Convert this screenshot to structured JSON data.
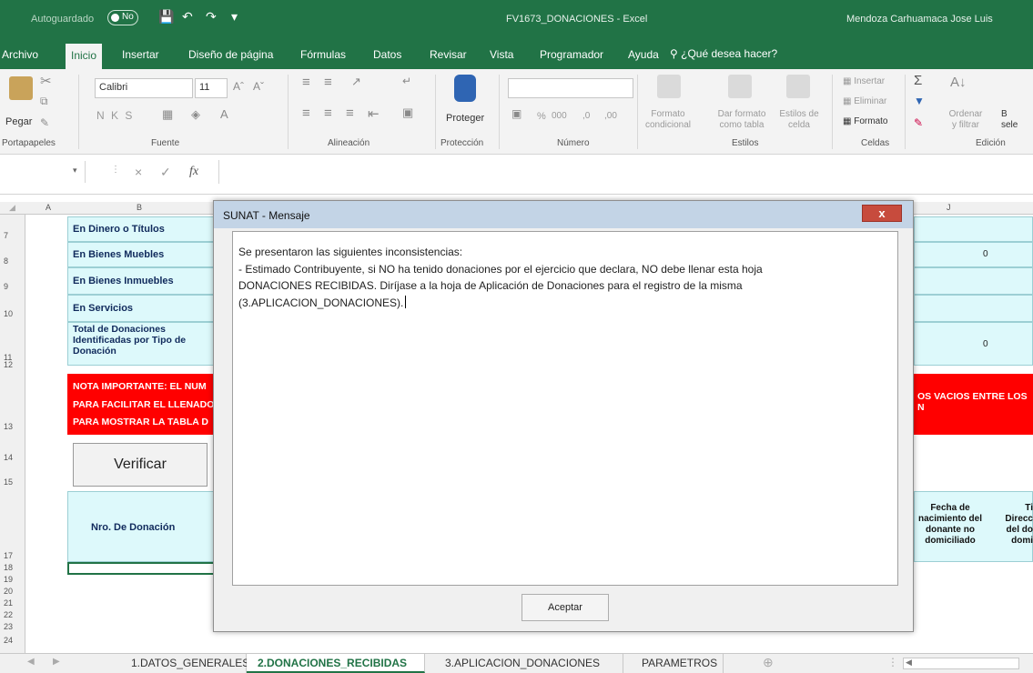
{
  "titlebar": {
    "autosave": "Autoguardado",
    "toggle_state": "No",
    "doc_title": "FV1673_DONACIONES - Excel",
    "user": "Mendoza Carhuamaca Jose Luis"
  },
  "ribbon_tabs": [
    "Archivo",
    "Inicio",
    "Insertar",
    "Diseño de página",
    "Fórmulas",
    "Datos",
    "Revisar",
    "Vista",
    "Programador",
    "Ayuda"
  ],
  "active_tab": "Inicio",
  "search": "¿Qué desea hacer?",
  "ribbon": {
    "paste": "Pegar",
    "font_name": "Calibri",
    "font_size": "11",
    "bold_italic_underline": "N  K  S",
    "protect": "Proteger",
    "conditional_format": "Formato\ncondicional",
    "format_table": "Dar formato\ncomo tabla",
    "cell_styles": "Estilos de\ncelda",
    "insert": "Insertar",
    "delete": "Eliminar",
    "format": "Formato",
    "sort_filter": "Ordenar\ny filtrar",
    "find_select": "B\nsele",
    "groups": [
      "Portapapeles",
      "Fuente",
      "Alineación",
      "Protección",
      "Número",
      "Estilos",
      "Celdas",
      "Edición"
    ]
  },
  "formula_bar": {
    "fx": "fx",
    "cancel": "×",
    "enter": "✓"
  },
  "columns": [
    "A",
    "B",
    "J"
  ],
  "rows": [
    "7",
    "8",
    "9",
    "10",
    "11",
    "12",
    "13",
    "14",
    "15",
    "17",
    "18",
    "19",
    "20",
    "21",
    "22",
    "23",
    "24"
  ],
  "sheet": {
    "row_labels": [
      "En Dinero o Títulos",
      "En Bienes Muebles",
      "En Bienes Inmuebles",
      "En Servicios",
      "Total de Donaciones Identificadas por Tipo de Donación"
    ],
    "zero_values": [
      "0",
      "0"
    ],
    "note_lines": [
      "NOTA IMPORTANTE: EL NUM",
      "PARA FACILITAR EL LLENADO",
      "PARA MOSTRAR LA TABLA D"
    ],
    "note_right": "OS VACIOS ENTRE LOS N",
    "verify_button": "Verificar",
    "donation_header": "Nro. De Donación",
    "header_birth": "Fecha de\nnacimiento del\ndonante no\ndomiciliado",
    "header_type": "Ti\nDirecc\ndel do\ndomi"
  },
  "dialog": {
    "title": "SUNAT - Mensaje",
    "close": "x",
    "message": "Se presentaron las siguientes inconsistencias:\n- Estimado Contribuyente, si NO ha tenido donaciones por el ejercicio que declara, NO debe llenar esta hoja\nDONACIONES RECIBIDAS. Diríjase a la hoja de Aplicación de Donaciones para el registro de la misma\n(3.APLICACION_DONACIONES).",
    "ok_button": "Aceptar"
  },
  "sheet_tabs": [
    "1.DATOS_GENERALES",
    "2.DONACIONES_RECIBIDAS",
    "3.APLICACION_DONACIONES",
    "PARAMETROS"
  ],
  "active_sheet": "2.DONACIONES_RECIBIDAS",
  "colors": {
    "excel_green": "#217346",
    "cyan_cell": "#ddf9fb",
    "red_band": "#ff0000"
  }
}
